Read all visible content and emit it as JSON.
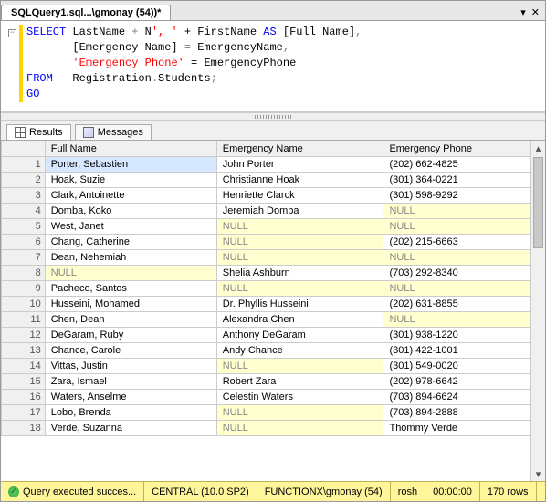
{
  "tab_title": "SQLQuery1.sql...\\gmonay (54))*",
  "sql": {
    "l1a": "SELECT",
    "l1b": " LastName ",
    "l1c": "+",
    "l1d": " N",
    "l1e": "', '",
    "l1f": " + ",
    "l1g": "FirstName ",
    "l1h": "AS",
    "l1i": " [Full Name]",
    "l1j": ",",
    "l2a": "       [Emergency Name] ",
    "l2b": "=",
    "l2c": " EmergencyName",
    "l2d": ",",
    "l3a": "       ",
    "l3b": "'Emergency Phone'",
    "l3c": " = ",
    "l3d": "EmergencyPhone",
    "l4a": "FROM",
    "l4b": "   Registration",
    "l4c": ".",
    "l4d": "Students",
    "l4e": ";",
    "l5": "GO"
  },
  "tabs": {
    "results": "Results",
    "messages": "Messages"
  },
  "cols": [
    "Full Name",
    "Emergency Name",
    "Emergency Phone"
  ],
  "rows": [
    {
      "n": 1,
      "a": "Porter, Sebastien",
      "b": "John Porter",
      "c": "(202) 662-4825",
      "sel": true
    },
    {
      "n": 2,
      "a": "Hoak, Suzie",
      "b": "Christianne Hoak",
      "c": "(301) 364-0221"
    },
    {
      "n": 3,
      "a": "Clark, Antoinette",
      "b": "Henriette Clarck",
      "c": "(301) 598-9292"
    },
    {
      "n": 4,
      "a": "Domba, Koko",
      "b": "Jeremiah Domba",
      "c": null
    },
    {
      "n": 5,
      "a": "West, Janet",
      "b": null,
      "c": null
    },
    {
      "n": 6,
      "a": "Chang, Catherine",
      "b": null,
      "c": "(202) 215-6663"
    },
    {
      "n": 7,
      "a": "Dean, Nehemiah",
      "b": null,
      "c": null
    },
    {
      "n": 8,
      "a": null,
      "b": "Shelia Ashburn",
      "c": "(703) 292-8340"
    },
    {
      "n": 9,
      "a": "Pacheco, Santos",
      "b": null,
      "c": null
    },
    {
      "n": 10,
      "a": "Husseini, Mohamed",
      "b": "Dr. Phyllis Husseini",
      "c": "(202) 631-8855"
    },
    {
      "n": 11,
      "a": "Chen, Dean",
      "b": "Alexandra Chen",
      "c": null
    },
    {
      "n": 12,
      "a": "DeGaram, Ruby",
      "b": "Anthony DeGaram",
      "c": "(301) 938-1220"
    },
    {
      "n": 13,
      "a": "Chance, Carole",
      "b": "Andy Chance",
      "c": "(301) 422-1001"
    },
    {
      "n": 14,
      "a": "Vittas, Justin",
      "b": null,
      "c": "(301) 549-0020"
    },
    {
      "n": 15,
      "a": "Zara, Ismael",
      "b": "Robert Zara",
      "c": "(202) 978-6642"
    },
    {
      "n": 16,
      "a": "Waters, Anselme",
      "b": "Celestin Waters",
      "c": "(703) 894-6624"
    },
    {
      "n": 17,
      "a": "Lobo, Brenda",
      "b": null,
      "c": "(703) 894-2888"
    },
    {
      "n": 18,
      "a": "Verde, Suzanna",
      "b": null,
      "c": "Thommy Verde"
    }
  ],
  "null_text": "NULL",
  "status": {
    "exec": "Query executed succes...",
    "server": "CENTRAL (10.0 SP2)",
    "conn": "FUNCTIONX\\gmonay (54)",
    "db": "rosh",
    "time": "00:00:00",
    "rows": "170 rows"
  }
}
